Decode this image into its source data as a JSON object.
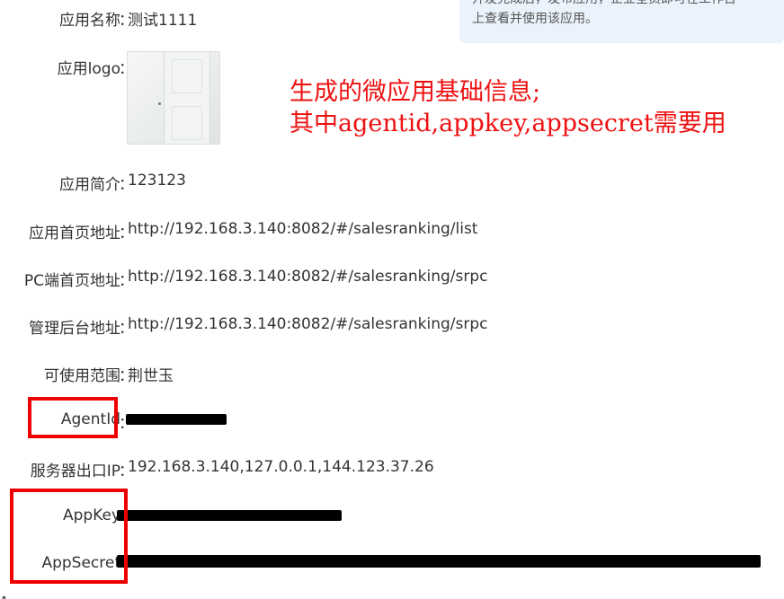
{
  "tip": {
    "line1": "开发完成后，发布应用，企业全员即可在工作台",
    "line2": "上查看并使用该应用。"
  },
  "colon": "：",
  "fields": {
    "app_name": {
      "label": "应用名称",
      "value": "测试1111"
    },
    "app_logo": {
      "label": "应用logo"
    },
    "app_intro": {
      "label": "应用简介",
      "value": "123123"
    },
    "home_url": {
      "label": "应用首页地址",
      "value": "http://192.168.3.140:8082/#/salesranking/list"
    },
    "pc_url": {
      "label": "PC端首页地址",
      "value": "http://192.168.3.140:8082/#/salesranking/srpc"
    },
    "admin_url": {
      "label": "管理后台地址",
      "value": "http://192.168.3.140:8082/#/salesranking/srpc"
    },
    "scope": {
      "label": "可使用范围",
      "value": "荆世玉"
    },
    "agent_id": {
      "label": "AgentId"
    },
    "server_ip": {
      "label": "服务器出口IP",
      "value": "192.168.3.140,127.0.0.1,144.123.37.26"
    },
    "app_key": {
      "label": "AppKey"
    },
    "app_secret": {
      "label": "AppSecret"
    }
  },
  "annotation": {
    "line1": "生成的微应用基础信息;",
    "line2": "其中agentid,appkey,appsecret需要用"
  },
  "colors": {
    "annotation_red": "#ee1111",
    "highlight_box_red": "#ee0000",
    "tip_background": "#eaf2fb",
    "redaction": "#000000"
  }
}
